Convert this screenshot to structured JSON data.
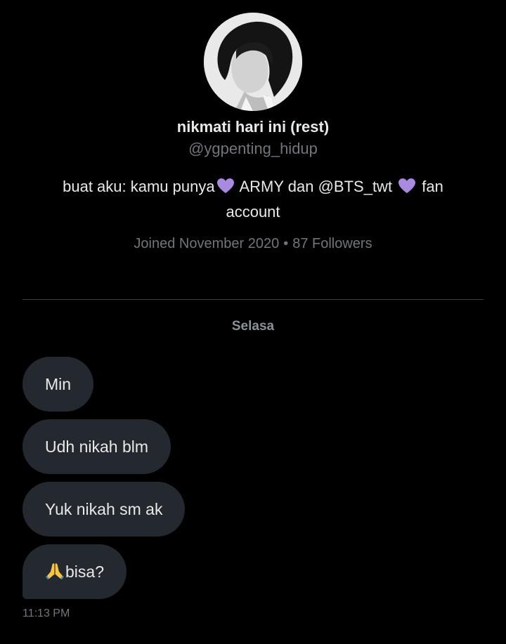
{
  "profile": {
    "display_name": "nikmati hari ini (rest)",
    "handle": "@ygpenting_hidup",
    "bio": {
      "part1": "buat aku: kamu punya",
      "part2": " ARMY dan @BTS_twt ",
      "part3": " fan account"
    },
    "heart_icon": "purple-heart-icon",
    "heart_color": "#a88ae0",
    "joined": "Joined November 2020",
    "separator": "•",
    "followers": "87 Followers"
  },
  "conversation": {
    "day_label": "Selasa",
    "messages": [
      {
        "text": "Min"
      },
      {
        "text": "Udh nikah blm"
      },
      {
        "text": "Yuk nikah sm ak"
      },
      {
        "text": "bisa?",
        "prefix_icon": "folded-hands-icon"
      }
    ],
    "timestamp": "11:13 PM"
  },
  "colors": {
    "background": "#000000",
    "bubble": "#23292f",
    "primary_text": "#e7e9ea",
    "secondary_text": "#71767b",
    "divider": "#3e4144"
  }
}
